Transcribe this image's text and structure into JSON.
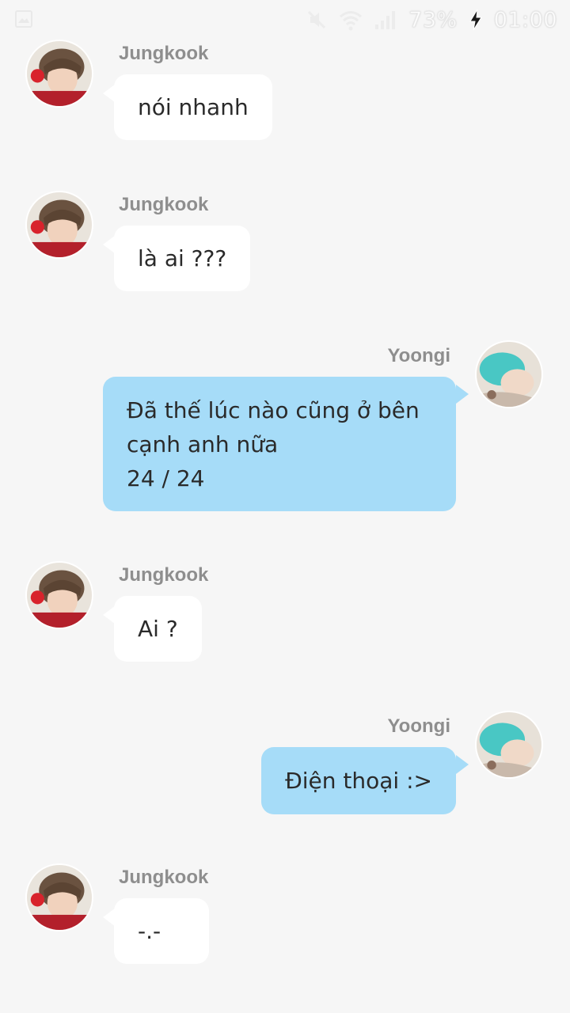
{
  "status_bar": {
    "battery_percent": "73%",
    "time": "01:00",
    "icons": [
      "image-icon",
      "mute-icon",
      "wifi-icon",
      "signal-icon",
      "charging-icon"
    ]
  },
  "colors": {
    "background": "#f6f6f6",
    "incoming_bubble": "#ffffff",
    "outgoing_bubble": "#a6dcf8",
    "sender_name": "#8e8e8e"
  },
  "messages": [
    {
      "sender": "Jungkook",
      "direction": "in",
      "text": "nói nhanh"
    },
    {
      "sender": "Jungkook",
      "direction": "in",
      "text": "là ai ???"
    },
    {
      "sender": "Yoongi",
      "direction": "out",
      "text": " Đã thế lúc nào cũng ở bên cạnh anh nữa\n24 / 24"
    },
    {
      "sender": "Jungkook",
      "direction": "in",
      "text": "Ai ?"
    },
    {
      "sender": "Yoongi",
      "direction": "out",
      "text": "Điện thoại :>"
    },
    {
      "sender": "Jungkook",
      "direction": "in",
      "text": "-.-"
    }
  ]
}
